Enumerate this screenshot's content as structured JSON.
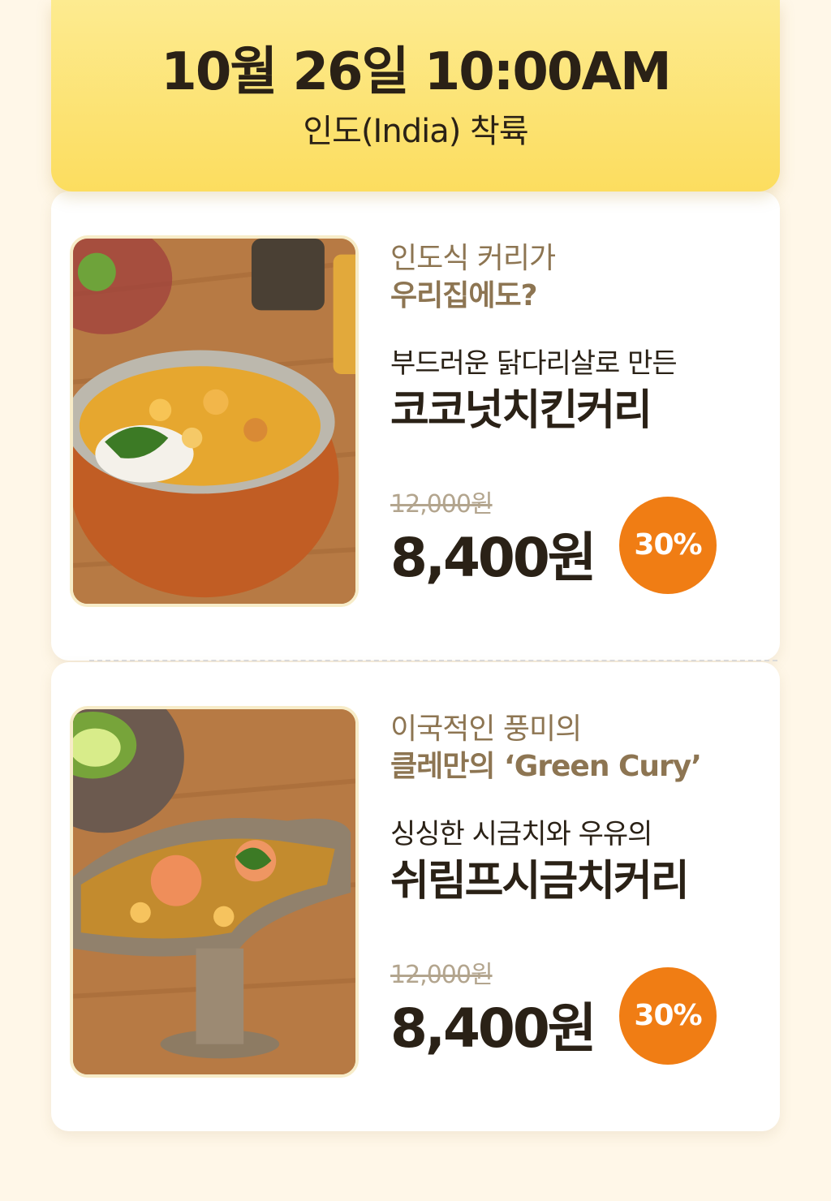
{
  "header": {
    "title": "10월 26일 10:00AM",
    "subtitle": "인도(India) 착륙"
  },
  "products": [
    {
      "tagline_line1": "인도식 커리가",
      "tagline_line2": "우리집에도?",
      "description": "부드러운 닭다리살로 만든",
      "name": "코코넛치킨커리",
      "original_price": "12,000원",
      "sale_price": "8,400원",
      "discount": "30%",
      "image_icon": "curry-bowl-photo"
    },
    {
      "tagline_line1": "이국적인 풍미의",
      "tagline_line2": "클레만의 ‘Green Cury’",
      "description": "싱싱한 시금치와 우유의",
      "name": "쉬림프시금치커리",
      "original_price": "12,000원",
      "sale_price": "8,400원",
      "discount": "30%",
      "image_icon": "shrimp-curry-boat-photo"
    }
  ],
  "colors": {
    "background": "#fff7e8",
    "header": "#fcdd5f",
    "badge": "#f07d14",
    "text_dark": "#2a2116",
    "text_muted": "#8d7552"
  }
}
